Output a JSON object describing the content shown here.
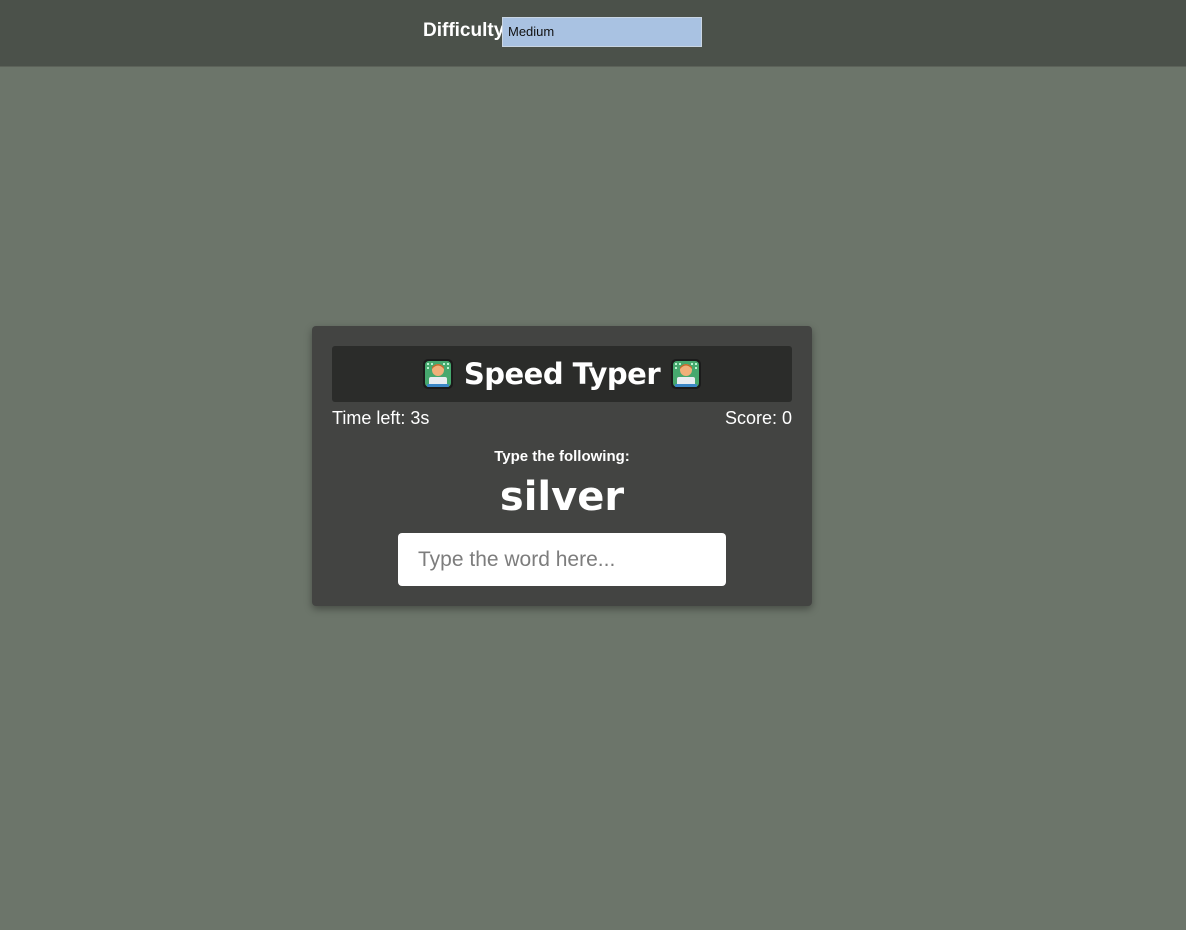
{
  "header": {
    "difficulty_label": "Difficulty",
    "difficulty_value": "Medium"
  },
  "game": {
    "title": "Speed Typer",
    "title_icon": "technologist-emoji-icon",
    "time_left": "Time left: 3s",
    "score": "Score: 0",
    "instruction": "Type the following:",
    "word": "silver",
    "input_placeholder": "Type the word here..."
  },
  "colors": {
    "background": "#6c756a",
    "topbar": "#4b514a",
    "card": "#434442",
    "title_bar": "#2b2c2a",
    "select_bg": "#a9c2e2"
  }
}
